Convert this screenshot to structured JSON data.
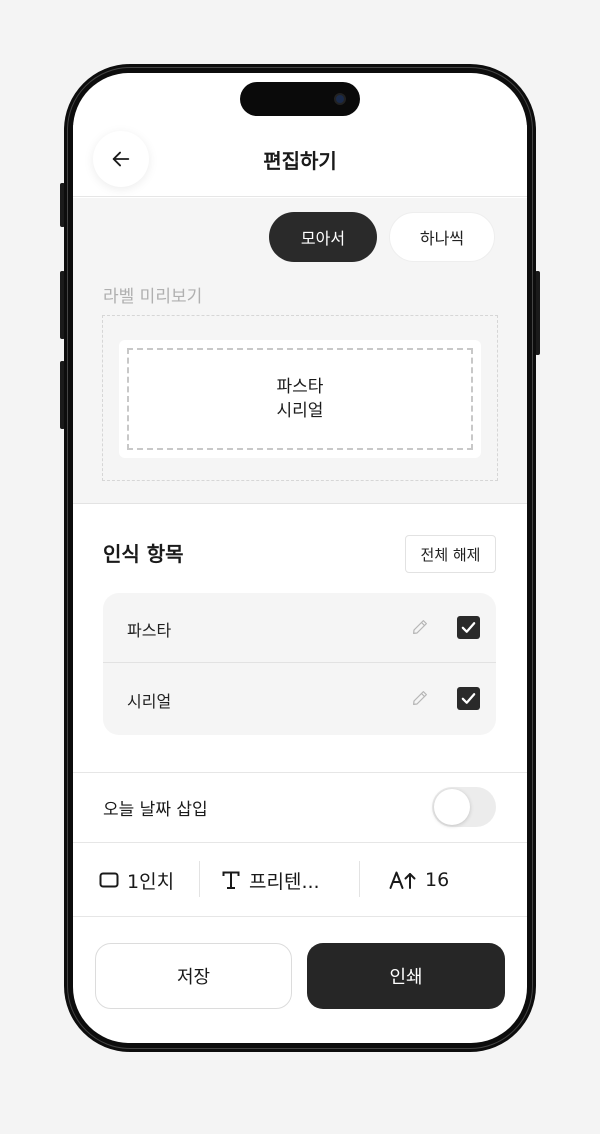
{
  "header": {
    "title": "편집하기",
    "back_icon": "arrow-left-icon"
  },
  "view_mode": {
    "options": [
      "모아서",
      "하나씩"
    ],
    "selected": "모아서"
  },
  "preview": {
    "label": "라벨 미리보기",
    "lines": [
      "파스타",
      "시리얼"
    ]
  },
  "recognized": {
    "title": "인식 항목",
    "clear_all_label": "전체 해제",
    "items": [
      {
        "name": "파스타",
        "checked": true
      },
      {
        "name": "시리얼",
        "checked": true
      }
    ]
  },
  "date_insert": {
    "label": "오늘 날짜 삽입",
    "enabled": false
  },
  "toolbar": {
    "size": {
      "value": "1인치",
      "icon": "label-size-icon"
    },
    "font": {
      "value": "프리텐...",
      "icon": "text-type-icon"
    },
    "font_size": {
      "value": "16",
      "icon": "font-size-icon"
    }
  },
  "actions": {
    "save_label": "저장",
    "print_label": "인쇄"
  },
  "colors": {
    "primary_dark": "#262626",
    "background": "#f5f5f5"
  }
}
